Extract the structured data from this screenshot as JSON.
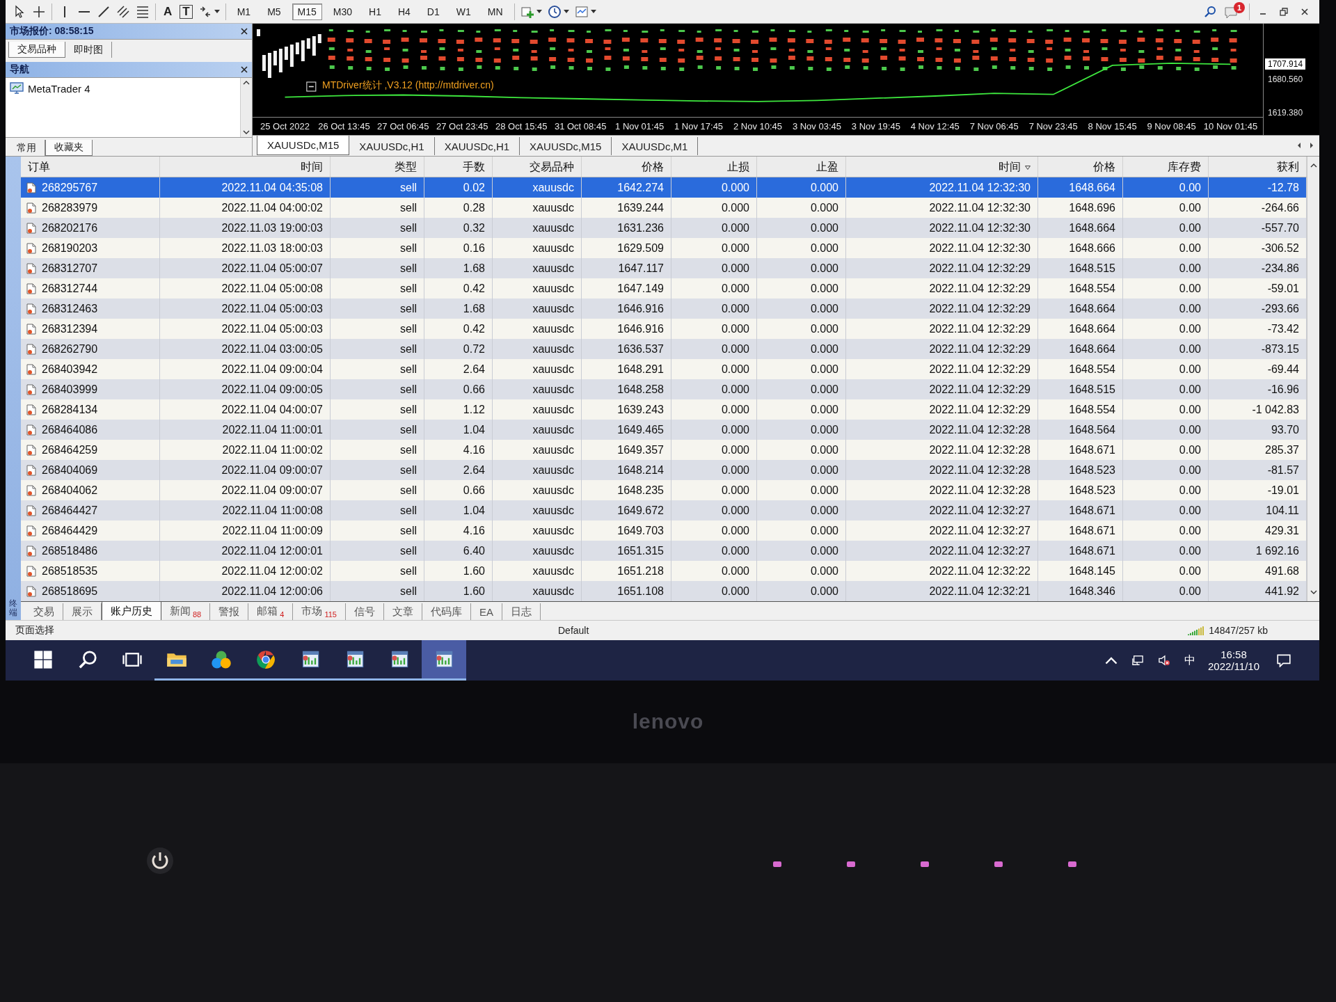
{
  "toolbar": {
    "text_tools": [
      {
        "kind": "text",
        "glyph": "A"
      },
      {
        "kind": "label",
        "glyph": "T"
      }
    ],
    "timeframes": [
      {
        "label": "M1",
        "selected": false
      },
      {
        "label": "M5",
        "selected": false
      },
      {
        "label": "M15",
        "selected": true
      },
      {
        "label": "M30",
        "selected": false
      },
      {
        "label": "H1",
        "selected": false
      },
      {
        "label": "H4",
        "selected": false
      },
      {
        "label": "D1",
        "selected": false
      },
      {
        "label": "W1",
        "selected": false
      },
      {
        "label": "MN",
        "selected": false
      }
    ]
  },
  "notifications": {
    "badge": "1"
  },
  "market_watch": {
    "title": "市场报价: 08:58:15",
    "tabs": [
      {
        "label": "交易品种",
        "selected": true
      },
      {
        "label": "即时图",
        "selected": false
      }
    ]
  },
  "navigator": {
    "title": "导航",
    "items": [
      {
        "label": "MetaTrader 4"
      }
    ],
    "tabs": [
      {
        "label": "常用",
        "selected": false
      },
      {
        "label": "收藏夹",
        "selected": true
      }
    ]
  },
  "chart": {
    "indicator_label": "MTDriver统计 ,V3.12 (http://mtdriver.cn)",
    "current_price": "1707.914",
    "chart_data": {
      "type": "line",
      "categories": [
        "25 Oct 2022",
        "26 Oct 13:45",
        "27 Oct 06:45",
        "27 Oct 23:45",
        "28 Oct 15:45",
        "31 Oct 08:45",
        "1 Nov 01:45",
        "1 Nov 17:45",
        "2 Nov 10:45",
        "3 Nov 03:45",
        "3 Nov 19:45",
        "4 Nov 12:45",
        "7 Nov 06:45",
        "7 Nov 23:45",
        "8 Nov 15:45",
        "9 Nov 08:45",
        "10 Nov 01:45"
      ],
      "series": [
        {
          "color": "#3ee83e",
          "values": [
            1648,
            1651,
            1652,
            1650,
            1647,
            1645,
            1643,
            1641,
            1640,
            1642,
            1646,
            1650,
            1655,
            1653,
            1706,
            1710,
            1708
          ]
        }
      ],
      "ylim": [
        1612,
        1782
      ],
      "yticks": [
        {
          "value": 1680.56,
          "label": "1680.560"
        },
        {
          "value": 1619.38,
          "label": "1619.380"
        }
      ]
    }
  },
  "chart_tabs": [
    {
      "label": "XAUUSDc,M15",
      "selected": true
    },
    {
      "label": "XAUUSDc,H1",
      "selected": false
    },
    {
      "label": "XAUUSDc,H1",
      "selected": false
    },
    {
      "label": "XAUUSDc,M15",
      "selected": false
    },
    {
      "label": "XAUUSDc,M1",
      "selected": false
    }
  ],
  "terminal": {
    "caption": "终端",
    "columns": [
      {
        "label": "订单",
        "sorted": false
      },
      {
        "label": "时间",
        "sorted": false
      },
      {
        "label": "类型",
        "sorted": false
      },
      {
        "label": "手数",
        "sorted": false
      },
      {
        "label": "交易品种",
        "sorted": false
      },
      {
        "label": "价格",
        "sorted": false
      },
      {
        "label": "止损",
        "sorted": false
      },
      {
        "label": "止盈",
        "sorted": false
      },
      {
        "label": "时间",
        "sorted": true
      },
      {
        "label": "价格",
        "sorted": false
      },
      {
        "label": "库存费",
        "sorted": false
      },
      {
        "label": "获利",
        "sorted": false
      }
    ],
    "rows": [
      {
        "selected": true,
        "cells": [
          "268295767",
          "2022.11.04 04:35:08",
          "sell",
          "0.02",
          "xauusdc",
          "1642.274",
          "0.000",
          "0.000",
          "2022.11.04 12:32:30",
          "1648.664",
          "0.00",
          "-12.78"
        ]
      },
      {
        "selected": false,
        "cells": [
          "268283979",
          "2022.11.04 04:00:02",
          "sell",
          "0.28",
          "xauusdc",
          "1639.244",
          "0.000",
          "0.000",
          "2022.11.04 12:32:30",
          "1648.696",
          "0.00",
          "-264.66"
        ]
      },
      {
        "selected": false,
        "cells": [
          "268202176",
          "2022.11.03 19:00:03",
          "sell",
          "0.32",
          "xauusdc",
          "1631.236",
          "0.000",
          "0.000",
          "2022.11.04 12:32:30",
          "1648.664",
          "0.00",
          "-557.70"
        ]
      },
      {
        "selected": false,
        "cells": [
          "268190203",
          "2022.11.03 18:00:03",
          "sell",
          "0.16",
          "xauusdc",
          "1629.509",
          "0.000",
          "0.000",
          "2022.11.04 12:32:30",
          "1648.666",
          "0.00",
          "-306.52"
        ]
      },
      {
        "selected": false,
        "cells": [
          "268312707",
          "2022.11.04 05:00:07",
          "sell",
          "1.68",
          "xauusdc",
          "1647.117",
          "0.000",
          "0.000",
          "2022.11.04 12:32:29",
          "1648.515",
          "0.00",
          "-234.86"
        ]
      },
      {
        "selected": false,
        "cells": [
          "268312744",
          "2022.11.04 05:00:08",
          "sell",
          "0.42",
          "xauusdc",
          "1647.149",
          "0.000",
          "0.000",
          "2022.11.04 12:32:29",
          "1648.554",
          "0.00",
          "-59.01"
        ]
      },
      {
        "selected": false,
        "cells": [
          "268312463",
          "2022.11.04 05:00:03",
          "sell",
          "1.68",
          "xauusdc",
          "1646.916",
          "0.000",
          "0.000",
          "2022.11.04 12:32:29",
          "1648.664",
          "0.00",
          "-293.66"
        ]
      },
      {
        "selected": false,
        "cells": [
          "268312394",
          "2022.11.04 05:00:03",
          "sell",
          "0.42",
          "xauusdc",
          "1646.916",
          "0.000",
          "0.000",
          "2022.11.04 12:32:29",
          "1648.664",
          "0.00",
          "-73.42"
        ]
      },
      {
        "selected": false,
        "cells": [
          "268262790",
          "2022.11.04 03:00:05",
          "sell",
          "0.72",
          "xauusdc",
          "1636.537",
          "0.000",
          "0.000",
          "2022.11.04 12:32:29",
          "1648.664",
          "0.00",
          "-873.15"
        ]
      },
      {
        "selected": false,
        "cells": [
          "268403942",
          "2022.11.04 09:00:04",
          "sell",
          "2.64",
          "xauusdc",
          "1648.291",
          "0.000",
          "0.000",
          "2022.11.04 12:32:29",
          "1648.554",
          "0.00",
          "-69.44"
        ]
      },
      {
        "selected": false,
        "cells": [
          "268403999",
          "2022.11.04 09:00:05",
          "sell",
          "0.66",
          "xauusdc",
          "1648.258",
          "0.000",
          "0.000",
          "2022.11.04 12:32:29",
          "1648.515",
          "0.00",
          "-16.96"
        ]
      },
      {
        "selected": false,
        "cells": [
          "268284134",
          "2022.11.04 04:00:07",
          "sell",
          "1.12",
          "xauusdc",
          "1639.243",
          "0.000",
          "0.000",
          "2022.11.04 12:32:29",
          "1648.554",
          "0.00",
          "-1 042.83"
        ]
      },
      {
        "selected": false,
        "cells": [
          "268464086",
          "2022.11.04 11:00:01",
          "sell",
          "1.04",
          "xauusdc",
          "1649.465",
          "0.000",
          "0.000",
          "2022.11.04 12:32:28",
          "1648.564",
          "0.00",
          "93.70"
        ]
      },
      {
        "selected": false,
        "cells": [
          "268464259",
          "2022.11.04 11:00:02",
          "sell",
          "4.16",
          "xauusdc",
          "1649.357",
          "0.000",
          "0.000",
          "2022.11.04 12:32:28",
          "1648.671",
          "0.00",
          "285.37"
        ]
      },
      {
        "selected": false,
        "cells": [
          "268404069",
          "2022.11.04 09:00:07",
          "sell",
          "2.64",
          "xauusdc",
          "1648.214",
          "0.000",
          "0.000",
          "2022.11.04 12:32:28",
          "1648.523",
          "0.00",
          "-81.57"
        ]
      },
      {
        "selected": false,
        "cells": [
          "268404062",
          "2022.11.04 09:00:07",
          "sell",
          "0.66",
          "xauusdc",
          "1648.235",
          "0.000",
          "0.000",
          "2022.11.04 12:32:28",
          "1648.523",
          "0.00",
          "-19.01"
        ]
      },
      {
        "selected": false,
        "cells": [
          "268464427",
          "2022.11.04 11:00:08",
          "sell",
          "1.04",
          "xauusdc",
          "1649.672",
          "0.000",
          "0.000",
          "2022.11.04 12:32:27",
          "1648.671",
          "0.00",
          "104.11"
        ]
      },
      {
        "selected": false,
        "cells": [
          "268464429",
          "2022.11.04 11:00:09",
          "sell",
          "4.16",
          "xauusdc",
          "1649.703",
          "0.000",
          "0.000",
          "2022.11.04 12:32:27",
          "1648.671",
          "0.00",
          "429.31"
        ]
      },
      {
        "selected": false,
        "cells": [
          "268518486",
          "2022.11.04 12:00:01",
          "sell",
          "6.40",
          "xauusdc",
          "1651.315",
          "0.000",
          "0.000",
          "2022.11.04 12:32:27",
          "1648.671",
          "0.00",
          "1 692.16"
        ]
      },
      {
        "selected": false,
        "cells": [
          "268518535",
          "2022.11.04 12:00:02",
          "sell",
          "1.60",
          "xauusdc",
          "1651.218",
          "0.000",
          "0.000",
          "2022.11.04 12:32:22",
          "1648.145",
          "0.00",
          "491.68"
        ]
      },
      {
        "selected": false,
        "cells": [
          "268518695",
          "2022.11.04 12:00:06",
          "sell",
          "1.60",
          "xauusdc",
          "1651.108",
          "0.000",
          "0.000",
          "2022.11.04 12:32:21",
          "1648.346",
          "0.00",
          "441.92"
        ]
      }
    ],
    "tabs": [
      {
        "label": "交易",
        "selected": false
      },
      {
        "label": "展示",
        "selected": false
      },
      {
        "label": "账户历史",
        "selected": true
      },
      {
        "label": "新闻",
        "badge": "88",
        "selected": false
      },
      {
        "label": "警报",
        "selected": false
      },
      {
        "label": "邮箱",
        "badge": "4",
        "selected": false
      },
      {
        "label": "市场",
        "badge": "115",
        "selected": false
      },
      {
        "label": "信号",
        "selected": false
      },
      {
        "label": "文章",
        "selected": false
      },
      {
        "label": "代码库",
        "selected": false
      },
      {
        "label": "EA",
        "selected": false
      },
      {
        "label": "日志",
        "selected": false
      }
    ]
  },
  "status_bar": {
    "hint": "页面选择",
    "profile": "Default",
    "traffic": "14847/257 kb"
  },
  "taskbar": {
    "apps": [
      {
        "kind": "folder",
        "selected": false
      },
      {
        "kind": "circles",
        "selected": false
      },
      {
        "kind": "browser",
        "selected": false
      },
      {
        "kind": "terminal",
        "selected": false
      },
      {
        "kind": "terminal",
        "selected": false
      },
      {
        "kind": "terminal",
        "selected": false
      },
      {
        "kind": "terminal",
        "selected": true
      }
    ],
    "ime": "中",
    "time": "16:58",
    "date": "2022/11/10"
  },
  "laptop": {
    "logo": "lenovo"
  }
}
